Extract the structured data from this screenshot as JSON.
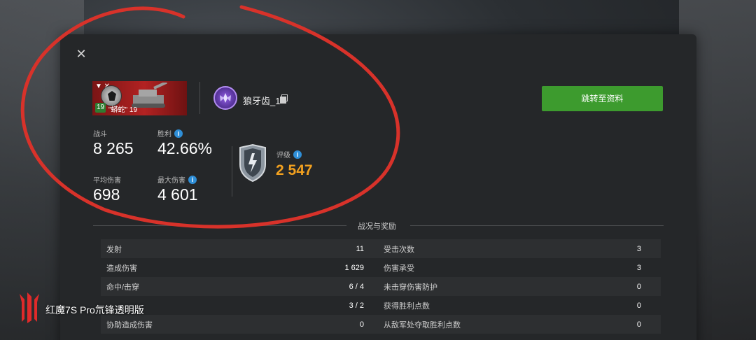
{
  "dialog": {
    "close_label": "✕",
    "profile_button": "跳转至资料"
  },
  "tank": {
    "flag_marker": "▼ ✕",
    "level": "19",
    "name": "\"蟒蛇\" 19",
    "nation_icon": "germany-eagle-icon"
  },
  "player": {
    "name": "狼牙齿_1",
    "clan_icon": "clan-wings-icon"
  },
  "stats": {
    "battles_label": "战斗",
    "battles_value": "8 265",
    "winrate_label": "胜利",
    "winrate_value": "42.66%",
    "avg_damage_label": "平均伤害",
    "avg_damage_value": "698",
    "max_damage_label": "最大伤害",
    "max_damage_value": "4 601",
    "rating_label": "评级",
    "rating_value": "2 547"
  },
  "section": {
    "title": "战况与奖励"
  },
  "table": {
    "rows": [
      {
        "left_label": "发射",
        "left_value": "11",
        "right_label": "受击次数",
        "right_value": "3"
      },
      {
        "left_label": "造成伤害",
        "left_value": "1 629",
        "right_label": "伤害承受",
        "right_value": "3"
      },
      {
        "left_label": "命中/击穿",
        "left_value": "6 / 4",
        "right_label": "未击穿伤害防护",
        "right_value": "0"
      },
      {
        "left_label": "",
        "left_value": "3 / 2",
        "right_label": "获得胜利点数",
        "right_value": "0"
      },
      {
        "left_label": "协助造成伤害",
        "left_value": "0",
        "right_label": "从敌军处夺取胜利点数",
        "right_value": "0"
      }
    ]
  },
  "watermark": {
    "text": "红魔7S Pro氘锋透明版"
  },
  "colors": {
    "accent_green": "#3d9b2e",
    "rating_orange": "#f3a11f",
    "info_blue": "#2f8fd8",
    "annotation_red": "#d8322a"
  }
}
